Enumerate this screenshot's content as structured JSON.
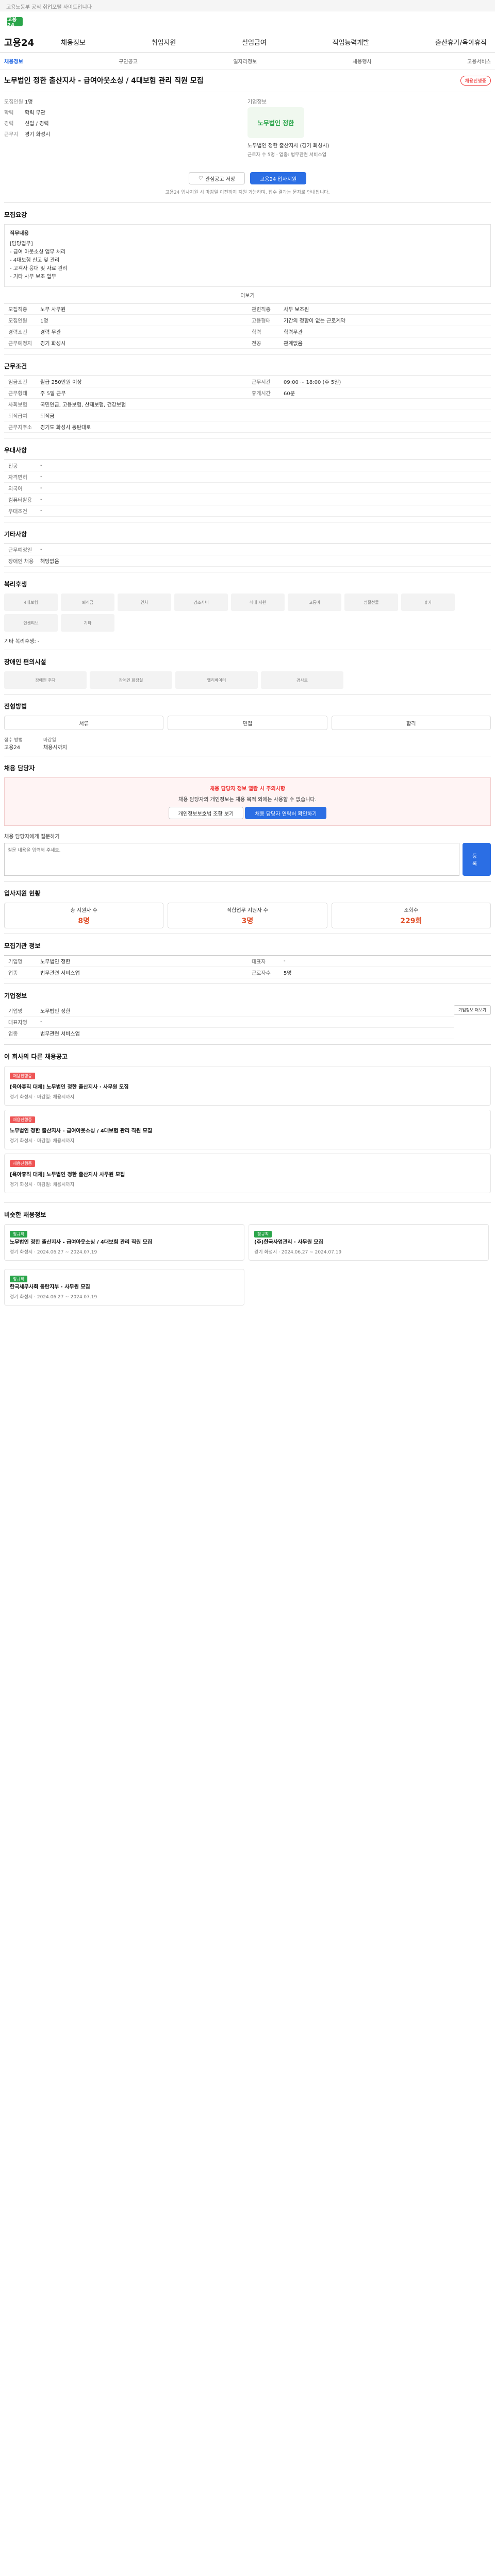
{
  "topbar": {
    "text": "고용노동부 공식 취업포털 사이트입니다"
  },
  "logo": {
    "text": "고용24"
  },
  "gnb": {
    "brand": "고용24",
    "menu": [
      "채용정보",
      "취업지원",
      "실업급여",
      "직업능력개발",
      "출산휴가/육아휴직"
    ]
  },
  "subnav": [
    "채용정보",
    "구인공고",
    "일자리정보",
    "채용행사",
    "고용서비스"
  ],
  "job": {
    "title": "노무법인 정한 출산지사 - 급여아웃소싱 / 4대보험 관리 직원 모집",
    "status": "채용진행중",
    "company_caption": "기업정보",
    "rows": [
      {
        "k": "모집인원",
        "v": "1명"
      },
      {
        "k": "학력",
        "v": "학력 무관"
      },
      {
        "k": "경력",
        "v": "신입 / 경력"
      },
      {
        "k": "근무지",
        "v": "경기 화성시"
      }
    ],
    "company_name": "노무법인 정한",
    "company_info": "노무법인 정한 출산지사 (경기 화성시)",
    "company_tags": "근로자 수 5명 · 업종: 법무관련 서비스업",
    "apply_label": "고용24 입사지원",
    "save_label": "관심공고 저장",
    "apply_note": "고용24 입사지원 시 마감일 이전까지 지원 가능하며, 접수 결과는 문자로 안내됩니다."
  },
  "recruit": {
    "title": "모집요강",
    "duty_title": "직무내용",
    "duty_body": "[담당업무]\n- 급여 아웃소싱 업무 처리\n- 4대보험 신고 및 관리\n- 고객사 응대 및 자료 관리\n- 기타 사무 보조 업무",
    "more": "더보기",
    "table": [
      {
        "h": "모집직종",
        "d": "노무 사무원"
      },
      {
        "h": "관련직종",
        "d": "사무 보조원"
      },
      {
        "h": "모집인원",
        "d": "1명"
      },
      {
        "h": "고용형태",
        "d": "기간의 정함이 없는 근로계약"
      },
      {
        "h": "경력조건",
        "d": "경력 무관"
      },
      {
        "h": "학력",
        "d": "학력무관"
      },
      {
        "h": "근무예정지",
        "d": "경기 화성시"
      },
      {
        "h": "전공",
        "d": "관계없음"
      }
    ]
  },
  "conditions": {
    "title": "근무조건",
    "table": [
      {
        "h": "임금조건",
        "d": "월급 250만원 이상"
      },
      {
        "h": "근무시간",
        "d": "09:00 ~ 18:00 (주 5일)"
      },
      {
        "h": "근무형태",
        "d": "주 5일 근무"
      },
      {
        "h": "휴게시간",
        "d": "60분"
      },
      {
        "h": "사회보험",
        "d": "국민연금, 고용보험, 산재보험, 건강보험"
      },
      {
        "h": "퇴직급여",
        "d": "퇴직금"
      },
      {
        "h": "근무지주소",
        "d": "경기도 화성시 동탄대로"
      }
    ]
  },
  "qualification": {
    "title": "우대사항",
    "table": [
      {
        "h": "전공",
        "d": "-"
      },
      {
        "h": "자격면허",
        "d": "-"
      },
      {
        "h": "외국어",
        "d": "-"
      },
      {
        "h": "컴퓨터활용",
        "d": "-"
      },
      {
        "h": "우대조건",
        "d": "-"
      }
    ]
  },
  "etc": {
    "title": "기타사항",
    "table": [
      {
        "h": "근무예정일",
        "d": "-"
      },
      {
        "h": "장애인 채용",
        "d": "해당없음"
      }
    ]
  },
  "welfare": {
    "title": "복리후생",
    "items": [
      "4대보험",
      "퇴직금",
      "연차",
      "경조사비",
      "식대 지원",
      "교통비",
      "명절선물",
      "휴가",
      "인센티브",
      "기타"
    ],
    "note": "기타 복리후생: -"
  },
  "disability": {
    "title": "장애인 편의시설",
    "items": [
      "장애인 주차",
      "장애인 화장실",
      "엘리베이터",
      "경사로"
    ]
  },
  "selection": {
    "title": "전형방법",
    "steps": [
      "서류",
      "면접",
      "합격"
    ],
    "method_label": "접수 방법",
    "method_value": "고용24",
    "deadline_label": "마감일",
    "deadline_value": "채용시까지"
  },
  "contact": {
    "title": "채용 담당자",
    "notice_head": "채용 담당자 정보 열람 시 주의사항",
    "notice_body": "채용 담당자의 개인정보는 채용 목적 외에는 사용할 수 없습니다.",
    "btn1": "개인정보보호법 조항 보기",
    "btn2": "채용 담당자 연락처 확인하기",
    "inquiry_label": "채용 담당자에게 질문하기",
    "inquiry_placeholder": "질문 내용을 입력해 주세요.",
    "submit": "등록"
  },
  "stats": {
    "title": "입사지원 현황",
    "items": [
      {
        "label": "총 지원자 수",
        "num": "8명"
      },
      {
        "label": "적합업무 지원자 수",
        "num": "3명"
      },
      {
        "label": "조회수",
        "num": "229회"
      }
    ]
  },
  "info": {
    "title": "모집기관 정보",
    "table": [
      {
        "h": "기업명",
        "d": "노무법인 정한"
      },
      {
        "h": "대표자",
        "d": "-"
      },
      {
        "h": "업종",
        "d": "법무관련 서비스업"
      },
      {
        "h": "근로자수",
        "d": "5명"
      }
    ]
  },
  "company": {
    "title": "기업정보",
    "rows": [
      {
        "h": "기업명",
        "d": "노무법인 정한"
      },
      {
        "h": "대표자명",
        "d": "-"
      },
      {
        "h": "업종",
        "d": "법무관련 서비스업"
      }
    ],
    "btn": "기업정보 더보기"
  },
  "related": {
    "title": "이 회사의 다른 채용공고",
    "jobs": [
      {
        "tag": "채용진행중",
        "title": "[육아휴직 대체] 노무법인 정한 출산지사 · 사무원 모집",
        "meta": "경기 화성시 · 마감일: 채용시까지"
      },
      {
        "tag": "채용진행중",
        "title": "노무법인 정한 출산지사 - 급여아웃소싱 / 4대보험 관리 직원 모집",
        "meta": "경기 화성시 · 마감일: 채용시까지"
      },
      {
        "tag": "채용진행중",
        "title": "[육아휴직 대체] 노무법인 정한 출산지사 사무원 모집",
        "meta": "경기 화성시 · 마감일: 채용시까지"
      }
    ]
  },
  "similar": {
    "title": "비슷한 채용정보",
    "jobs": [
      {
        "tag": "정규직",
        "title": "노무법인 정한 출산지사 - 급여아웃소싱 / 4대보험 관리 직원 모집",
        "meta": "경기 화성시 · 2024.06.27 ~ 2024.07.19"
      },
      {
        "tag": "정규직",
        "title": "(주)한국사업관리 · 사무원 모집",
        "meta": "경기 화성시 · 2024.06.27 ~ 2024.07.19"
      },
      {
        "tag": "정규직",
        "title": "한국세무사회 동탄지부 · 사무원 모집",
        "meta": "경기 화성시 · 2024.06.27 ~ 2024.07.19"
      }
    ]
  }
}
